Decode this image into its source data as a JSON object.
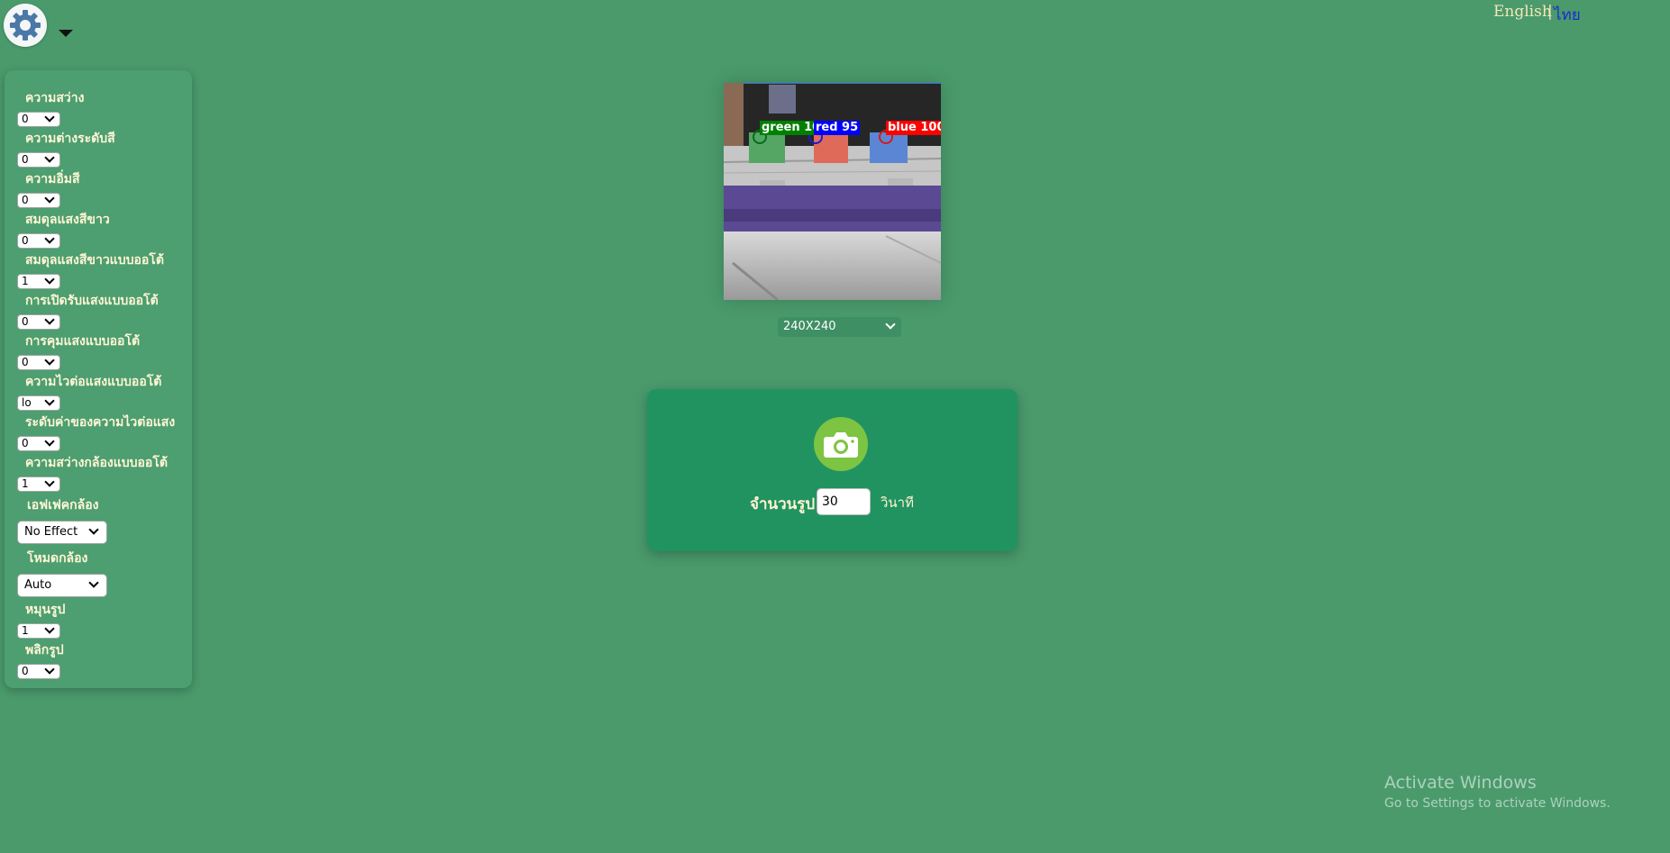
{
  "header": {
    "lang_en": "English",
    "lang_sep": "|",
    "lang_th": "ไทย"
  },
  "sidebar": {
    "controls": [
      {
        "label": "ความสว่าง",
        "value": "0"
      },
      {
        "label": "ความต่างระดับสี",
        "value": "0"
      },
      {
        "label": "ความอิ่มสี",
        "value": "0"
      },
      {
        "label": "สมดุลแสงสีขาว",
        "value": "0"
      },
      {
        "label": "สมดุลแสงสีขาวแบบออโต้",
        "value": "1"
      },
      {
        "label": "การเปิดรับแสงแบบออโต้",
        "value": "0"
      },
      {
        "label": "การคุมแสงแบบออโต้",
        "value": "0"
      },
      {
        "label": "ความไวต่อแสงแบบออโต้",
        "value": "lo"
      },
      {
        "label": "ระดับค่าของความไวต่อแสง",
        "value": "0"
      },
      {
        "label": "ความสว่างกล้องแบบออโต้",
        "value": "1"
      },
      {
        "label": "เอฟเฟคกล้อง",
        "value": "No Effect"
      },
      {
        "label": "โหมดกล้อง",
        "value": "Auto"
      },
      {
        "label": "หมุนรูป",
        "value": "1"
      },
      {
        "label": "พลิกรูป",
        "value": "0"
      }
    ]
  },
  "camera": {
    "labels": [
      "green 100",
      "red 95",
      "blue 100"
    ],
    "label_colors": [
      "#008000",
      "#0000ff",
      "#ff0000"
    ],
    "resolution": "240X240"
  },
  "capture": {
    "count_label": "จำนวนรูป",
    "count_value": "30",
    "unit_label": "วินาที"
  },
  "watermark": {
    "title": "Activate Windows",
    "subtitle": "Go to Settings to activate Windows."
  }
}
